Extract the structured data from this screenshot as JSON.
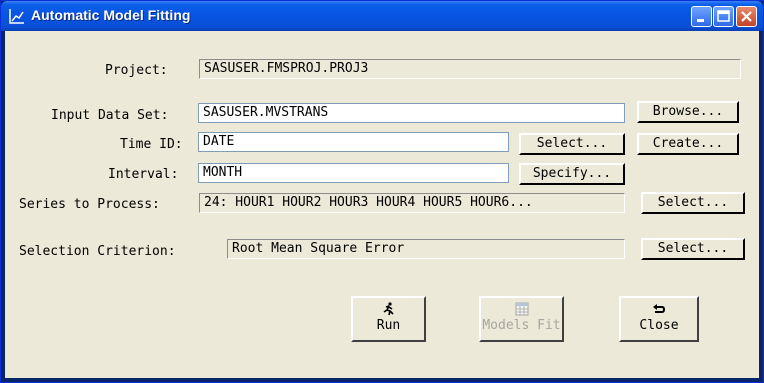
{
  "window": {
    "title": "Automatic Model Fitting"
  },
  "form": {
    "project_label": "Project:",
    "project_value": "SASUSER.FMSPROJ.PROJ3",
    "input_label": "Input Data Set:",
    "input_value": "SASUSER.MVSTRANS",
    "browse_label": "Browse...",
    "timeid_label": "Time ID:",
    "timeid_value": "DATE",
    "timeid_select_label": "Select...",
    "create_label": "Create...",
    "interval_label": "Interval:",
    "interval_value": "MONTH",
    "specify_label": "Specify...",
    "series_label": "Series to Process:",
    "series_value": "24: HOUR1 HOUR2 HOUR3 HOUR4 HOUR5 HOUR6...",
    "series_select_label": "Select...",
    "criterion_label": "Selection Criterion:",
    "criterion_value": "Root Mean Square Error",
    "criterion_select_label": "Select..."
  },
  "actions": {
    "run_label": "Run",
    "models_fit_label": "Models Fit",
    "close_label": "Close"
  },
  "icons": {
    "app": "chart-icon",
    "run": "running-man-icon",
    "models_fit": "table-icon",
    "close": "return-arrow-icon"
  }
}
